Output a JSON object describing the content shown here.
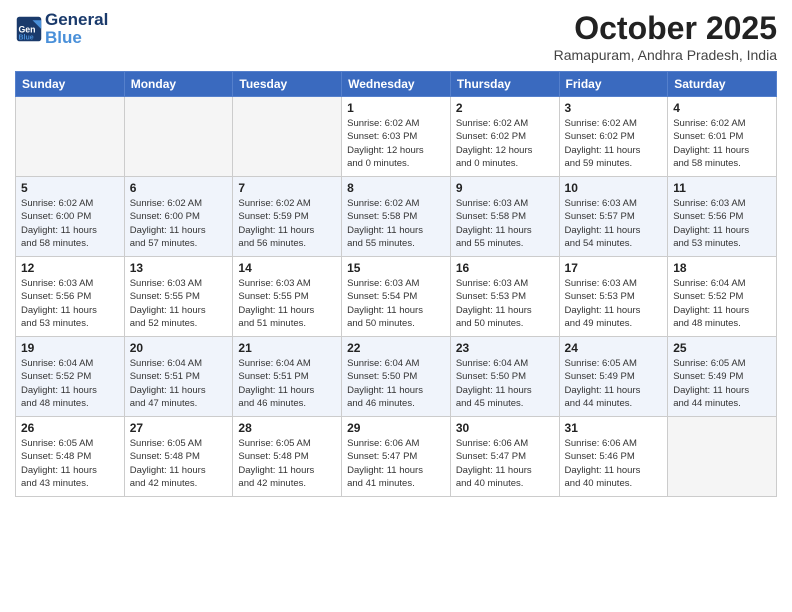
{
  "header": {
    "logo_line1": "General",
    "logo_line2": "Blue",
    "month": "October 2025",
    "location": "Ramapuram, Andhra Pradesh, India"
  },
  "weekdays": [
    "Sunday",
    "Monday",
    "Tuesday",
    "Wednesday",
    "Thursday",
    "Friday",
    "Saturday"
  ],
  "weeks": [
    [
      {
        "day": "",
        "info": ""
      },
      {
        "day": "",
        "info": ""
      },
      {
        "day": "",
        "info": ""
      },
      {
        "day": "1",
        "info": "Sunrise: 6:02 AM\nSunset: 6:03 PM\nDaylight: 12 hours\nand 0 minutes."
      },
      {
        "day": "2",
        "info": "Sunrise: 6:02 AM\nSunset: 6:02 PM\nDaylight: 12 hours\nand 0 minutes."
      },
      {
        "day": "3",
        "info": "Sunrise: 6:02 AM\nSunset: 6:02 PM\nDaylight: 11 hours\nand 59 minutes."
      },
      {
        "day": "4",
        "info": "Sunrise: 6:02 AM\nSunset: 6:01 PM\nDaylight: 11 hours\nand 58 minutes."
      }
    ],
    [
      {
        "day": "5",
        "info": "Sunrise: 6:02 AM\nSunset: 6:00 PM\nDaylight: 11 hours\nand 58 minutes."
      },
      {
        "day": "6",
        "info": "Sunrise: 6:02 AM\nSunset: 6:00 PM\nDaylight: 11 hours\nand 57 minutes."
      },
      {
        "day": "7",
        "info": "Sunrise: 6:02 AM\nSunset: 5:59 PM\nDaylight: 11 hours\nand 56 minutes."
      },
      {
        "day": "8",
        "info": "Sunrise: 6:02 AM\nSunset: 5:58 PM\nDaylight: 11 hours\nand 55 minutes."
      },
      {
        "day": "9",
        "info": "Sunrise: 6:03 AM\nSunset: 5:58 PM\nDaylight: 11 hours\nand 55 minutes."
      },
      {
        "day": "10",
        "info": "Sunrise: 6:03 AM\nSunset: 5:57 PM\nDaylight: 11 hours\nand 54 minutes."
      },
      {
        "day": "11",
        "info": "Sunrise: 6:03 AM\nSunset: 5:56 PM\nDaylight: 11 hours\nand 53 minutes."
      }
    ],
    [
      {
        "day": "12",
        "info": "Sunrise: 6:03 AM\nSunset: 5:56 PM\nDaylight: 11 hours\nand 53 minutes."
      },
      {
        "day": "13",
        "info": "Sunrise: 6:03 AM\nSunset: 5:55 PM\nDaylight: 11 hours\nand 52 minutes."
      },
      {
        "day": "14",
        "info": "Sunrise: 6:03 AM\nSunset: 5:55 PM\nDaylight: 11 hours\nand 51 minutes."
      },
      {
        "day": "15",
        "info": "Sunrise: 6:03 AM\nSunset: 5:54 PM\nDaylight: 11 hours\nand 50 minutes."
      },
      {
        "day": "16",
        "info": "Sunrise: 6:03 AM\nSunset: 5:53 PM\nDaylight: 11 hours\nand 50 minutes."
      },
      {
        "day": "17",
        "info": "Sunrise: 6:03 AM\nSunset: 5:53 PM\nDaylight: 11 hours\nand 49 minutes."
      },
      {
        "day": "18",
        "info": "Sunrise: 6:04 AM\nSunset: 5:52 PM\nDaylight: 11 hours\nand 48 minutes."
      }
    ],
    [
      {
        "day": "19",
        "info": "Sunrise: 6:04 AM\nSunset: 5:52 PM\nDaylight: 11 hours\nand 48 minutes."
      },
      {
        "day": "20",
        "info": "Sunrise: 6:04 AM\nSunset: 5:51 PM\nDaylight: 11 hours\nand 47 minutes."
      },
      {
        "day": "21",
        "info": "Sunrise: 6:04 AM\nSunset: 5:51 PM\nDaylight: 11 hours\nand 46 minutes."
      },
      {
        "day": "22",
        "info": "Sunrise: 6:04 AM\nSunset: 5:50 PM\nDaylight: 11 hours\nand 46 minutes."
      },
      {
        "day": "23",
        "info": "Sunrise: 6:04 AM\nSunset: 5:50 PM\nDaylight: 11 hours\nand 45 minutes."
      },
      {
        "day": "24",
        "info": "Sunrise: 6:05 AM\nSunset: 5:49 PM\nDaylight: 11 hours\nand 44 minutes."
      },
      {
        "day": "25",
        "info": "Sunrise: 6:05 AM\nSunset: 5:49 PM\nDaylight: 11 hours\nand 44 minutes."
      }
    ],
    [
      {
        "day": "26",
        "info": "Sunrise: 6:05 AM\nSunset: 5:48 PM\nDaylight: 11 hours\nand 43 minutes."
      },
      {
        "day": "27",
        "info": "Sunrise: 6:05 AM\nSunset: 5:48 PM\nDaylight: 11 hours\nand 42 minutes."
      },
      {
        "day": "28",
        "info": "Sunrise: 6:05 AM\nSunset: 5:48 PM\nDaylight: 11 hours\nand 42 minutes."
      },
      {
        "day": "29",
        "info": "Sunrise: 6:06 AM\nSunset: 5:47 PM\nDaylight: 11 hours\nand 41 minutes."
      },
      {
        "day": "30",
        "info": "Sunrise: 6:06 AM\nSunset: 5:47 PM\nDaylight: 11 hours\nand 40 minutes."
      },
      {
        "day": "31",
        "info": "Sunrise: 6:06 AM\nSunset: 5:46 PM\nDaylight: 11 hours\nand 40 minutes."
      },
      {
        "day": "",
        "info": ""
      }
    ]
  ]
}
